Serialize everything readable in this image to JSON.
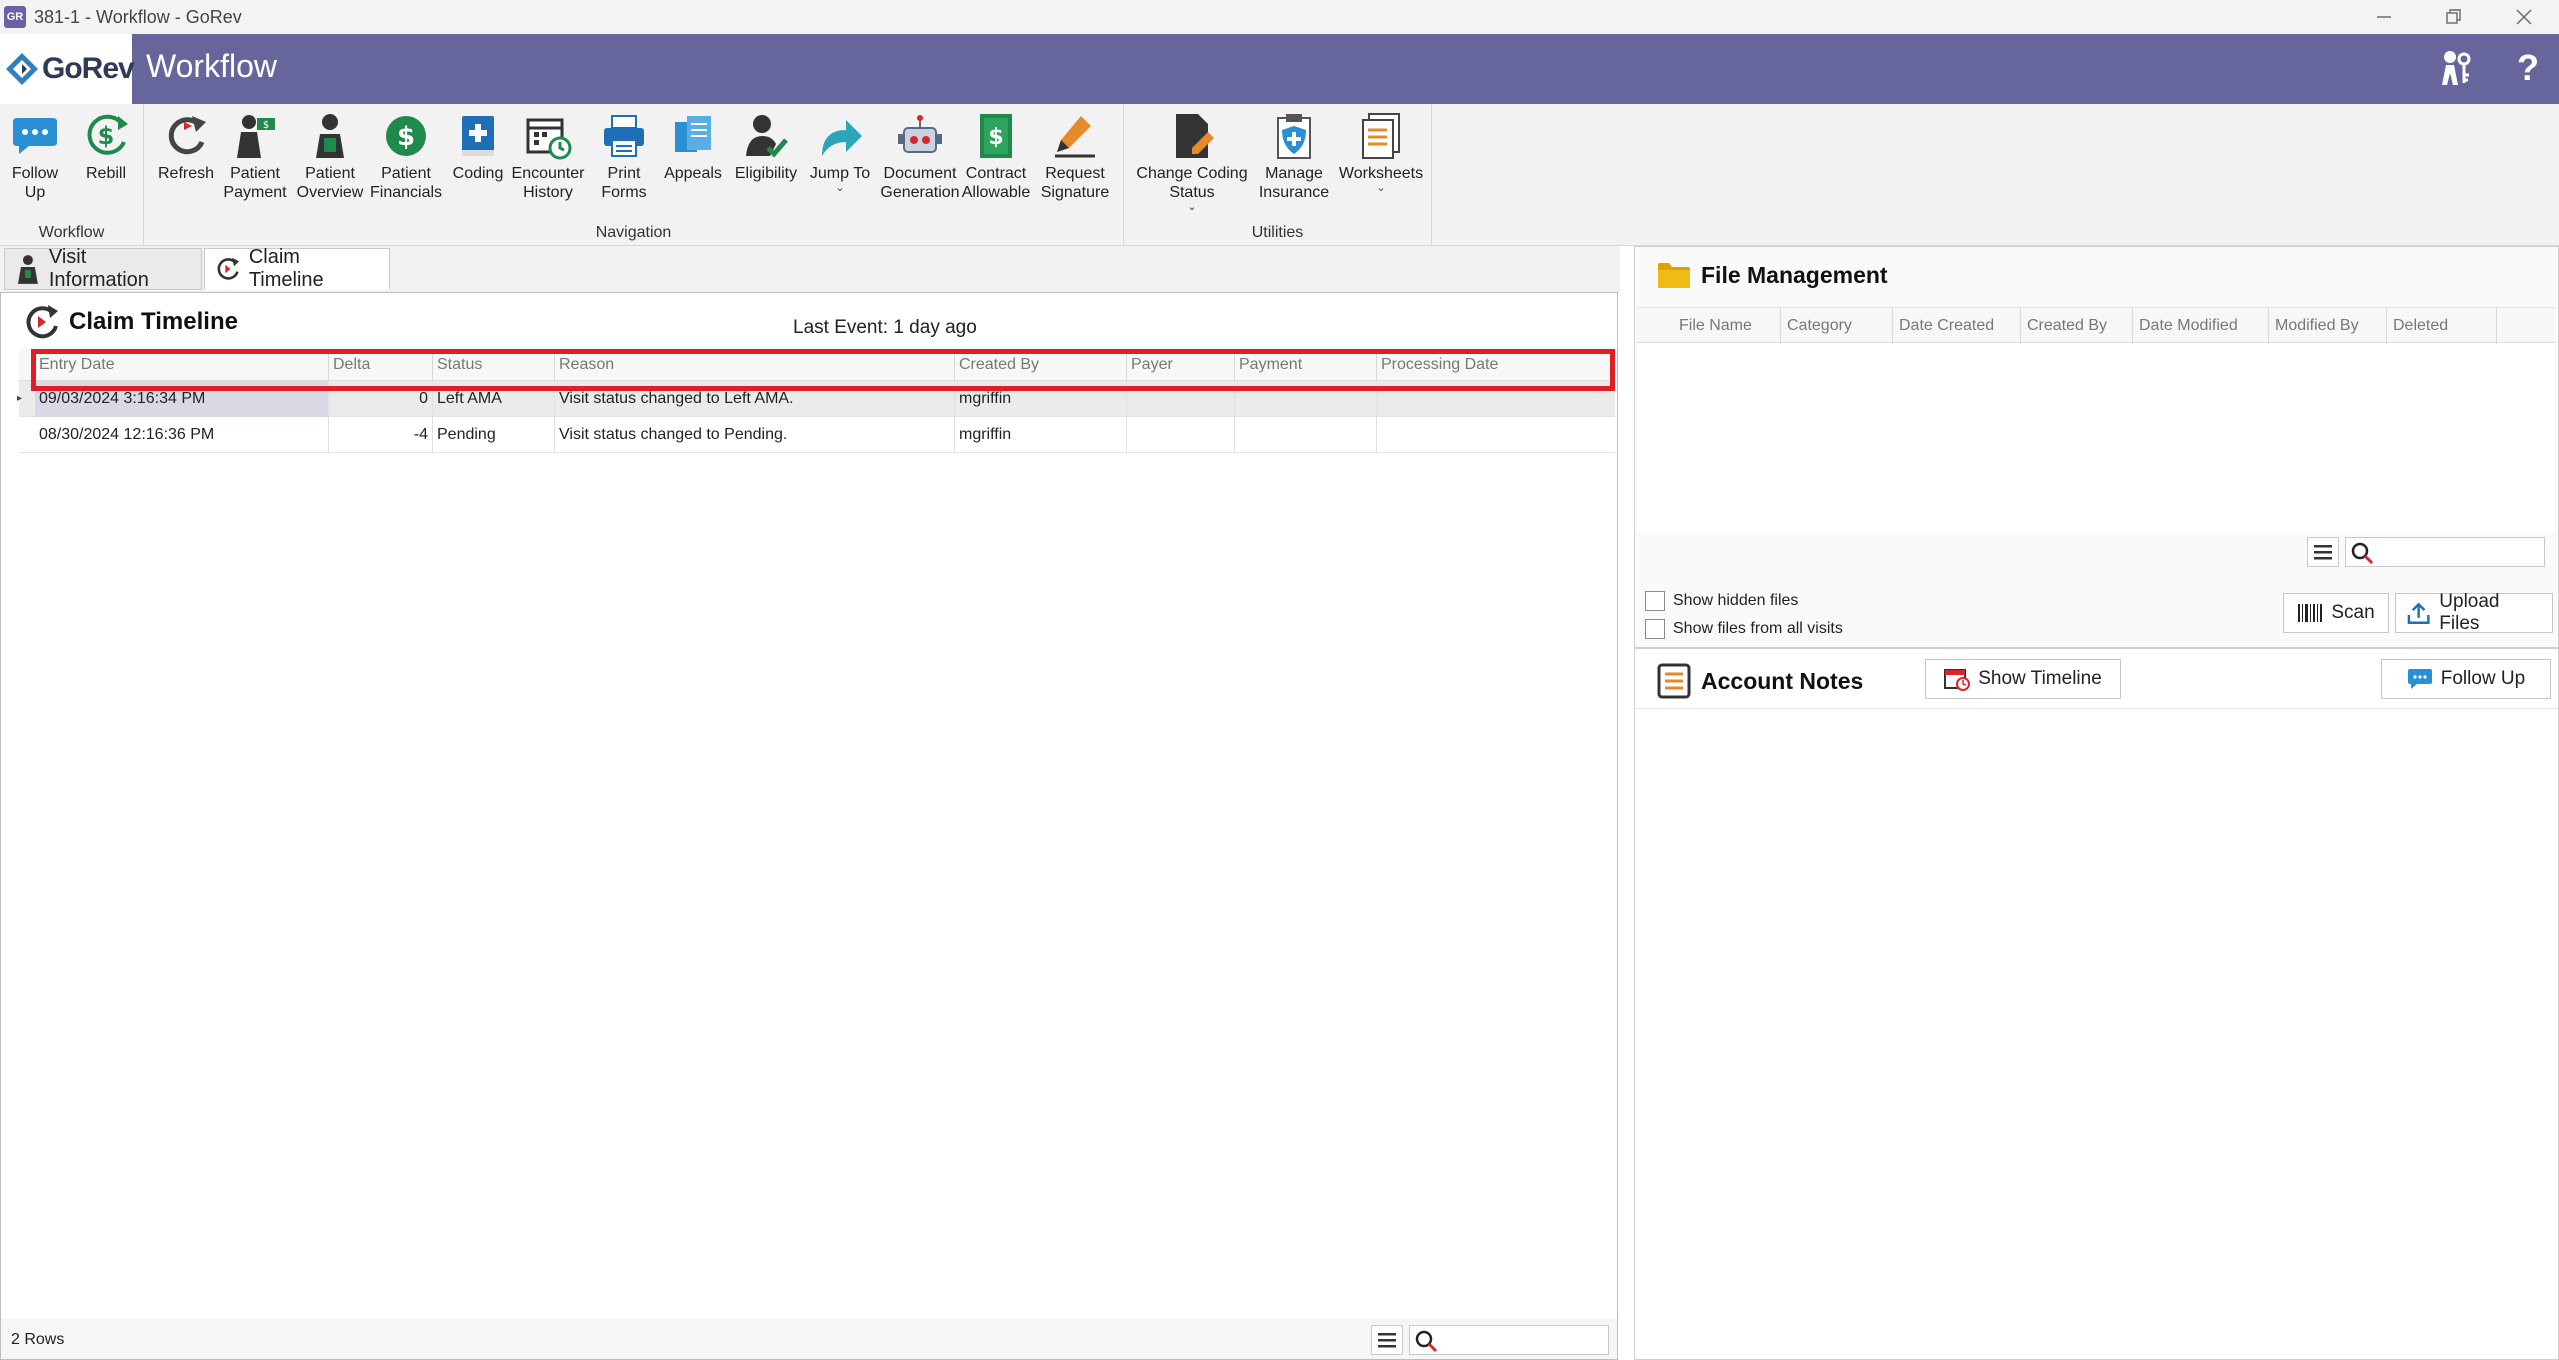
{
  "window": {
    "title": "381-1 - Workflow - GoRev",
    "app_icon": "GR"
  },
  "header": {
    "logo_text": "GoRev",
    "title": "Workflow",
    "icons": [
      "people-keys-icon",
      "help-icon"
    ],
    "help_glyph": "?",
    "bg_color": "#66669c"
  },
  "ribbon": {
    "groups": {
      "workflow": "Workflow",
      "navigation": "Navigation",
      "utilities": "Utilities"
    },
    "buttons": {
      "follow_up": "Follow\nUp",
      "rebill": "Rebill",
      "refresh": "Refresh",
      "patient_payment": "Patient\nPayment",
      "patient_overview": "Patient\nOverview",
      "patient_financials": "Patient\nFinancials",
      "coding": "Coding",
      "encounter_history": "Encounter\nHistory",
      "print_forms": "Print\nForms",
      "appeals": "Appeals",
      "eligibility": "Eligibility",
      "jump_to": "Jump To",
      "document_generation": "Document\nGeneration",
      "contract_allowable": "Contract\nAllowable",
      "request_signature": "Request\nSignature",
      "change_coding_status": "Change Coding\nStatus",
      "manage_insurance": "Manage\nInsurance",
      "worksheets": "Worksheets"
    },
    "caret": "⌄"
  },
  "tabs": {
    "visit_information": "Visit Information",
    "claim_timeline": "Claim Timeline",
    "active": "claim_timeline"
  },
  "claim_timeline": {
    "title": "Claim Timeline",
    "last_event": "Last Event: 1 day ago",
    "columns": [
      "Entry Date",
      "Delta",
      "Status",
      "Reason",
      "Created By",
      "Payer",
      "Payment",
      "Processing Date"
    ],
    "rows": [
      {
        "entry_date": "09/03/2024 3:16:34 PM",
        "delta": "0",
        "status": "Left AMA",
        "reason": "Visit status changed to Left AMA.",
        "created_by": "mgriffin",
        "payer": "",
        "payment": "",
        "processing_date": ""
      },
      {
        "entry_date": "08/30/2024 12:16:36 PM",
        "delta": "-4",
        "status": "Pending",
        "reason": "Visit status changed to Pending.",
        "created_by": "mgriffin",
        "payer": "",
        "payment": "",
        "processing_date": ""
      }
    ],
    "row_indicator": "▸",
    "row_count": "2 Rows",
    "search_value": "",
    "highlight_color": "#e01e24"
  },
  "file_management": {
    "title": "File Management",
    "columns": [
      "File Name",
      "Category",
      "Date Created",
      "Created By",
      "Date Modified",
      "Modified By",
      "Deleted"
    ],
    "search_value": "",
    "show_hidden_files": "Show hidden files",
    "show_files_all_visits": "Show files from all visits",
    "scan_label": "Scan",
    "upload_label": "Upload Files"
  },
  "account_notes": {
    "title": "Account Notes",
    "show_timeline_label": "Show Timeline",
    "follow_up_label": "Follow Up"
  }
}
